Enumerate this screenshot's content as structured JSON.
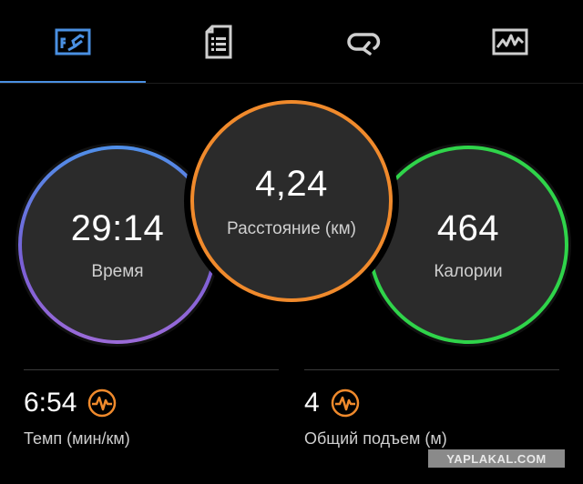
{
  "tabs": [
    {
      "name": "stats",
      "icon": "stats-chart-icon",
      "active": true
    },
    {
      "name": "details",
      "icon": "document-list-icon",
      "active": false
    },
    {
      "name": "laps",
      "icon": "loop-arrow-icon",
      "active": false
    },
    {
      "name": "graphs",
      "icon": "activity-graph-icon",
      "active": false
    }
  ],
  "circles": {
    "time": {
      "value": "29:14",
      "label": "Время",
      "color": "#4f8fe8"
    },
    "distance": {
      "value": "4,24",
      "label": "Расстояние (км)",
      "color": "#f08a2c"
    },
    "calories": {
      "value": "464",
      "label": "Калории",
      "color": "#2fd44a"
    }
  },
  "metrics": {
    "pace": {
      "value": "6:54",
      "label": "Темп (мин/км)",
      "icon": "pulse-wave-icon"
    },
    "ascent": {
      "value": "4",
      "label": "Общий подъем (м)",
      "icon": "pulse-wave-icon"
    }
  },
  "colors": {
    "accent": "#4a90e2",
    "icon_orange": "#f08a2c",
    "background": "#000000"
  },
  "watermark": "YAPLAKAL.COM"
}
